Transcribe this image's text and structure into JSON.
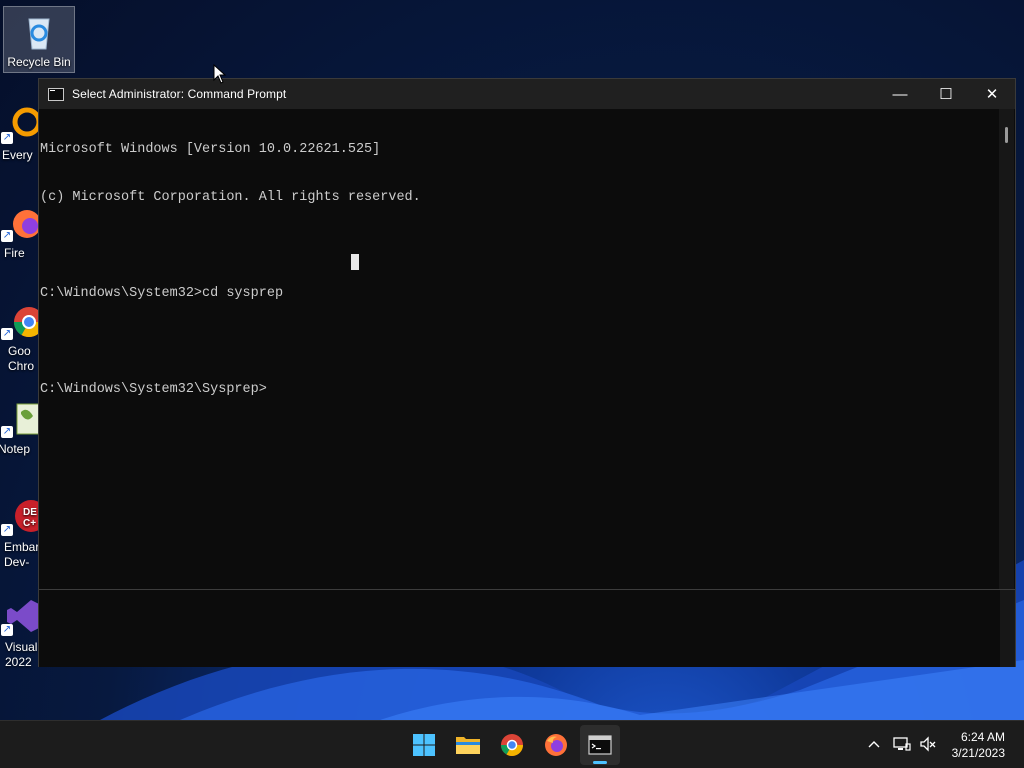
{
  "desktop": {
    "icons": [
      {
        "label": "Recycle Bin"
      },
      {
        "label": "Every"
      },
      {
        "label": "Fire"
      },
      {
        "label": "Goo\nChro"
      },
      {
        "label": "Notep"
      },
      {
        "label": "Embar\nDev-"
      },
      {
        "label": "Visual\n2022"
      }
    ]
  },
  "window": {
    "title": "Select Administrator: Command Prompt",
    "buttons": {
      "minimize": "—",
      "maximize": "☐",
      "close": "✕"
    },
    "console_lines": [
      "Microsoft Windows [Version 10.0.22621.525]",
      "(c) Microsoft Corporation. All rights reserved.",
      "",
      "C:\\Windows\\System32>cd sysprep",
      "",
      "C:\\Windows\\System32\\Sysprep>"
    ]
  },
  "taskbar": {
    "apps": [
      {
        "name": "start-icon"
      },
      {
        "name": "file-explorer-icon"
      },
      {
        "name": "chrome-icon"
      },
      {
        "name": "firefox-icon"
      },
      {
        "name": "command-prompt-icon",
        "active": true
      }
    ],
    "tray": [
      "chevron-up-icon",
      "network-icon",
      "volume-muted-icon"
    ],
    "time": "6:24 AM",
    "date": "3/21/2023"
  },
  "colors": {
    "console_bg": "#0c0c0c",
    "console_text": "#cccccc",
    "titlebar_bg": "#202020",
    "taskbar_bg": "#1c1c1c",
    "accent": "#4cc2ff"
  }
}
